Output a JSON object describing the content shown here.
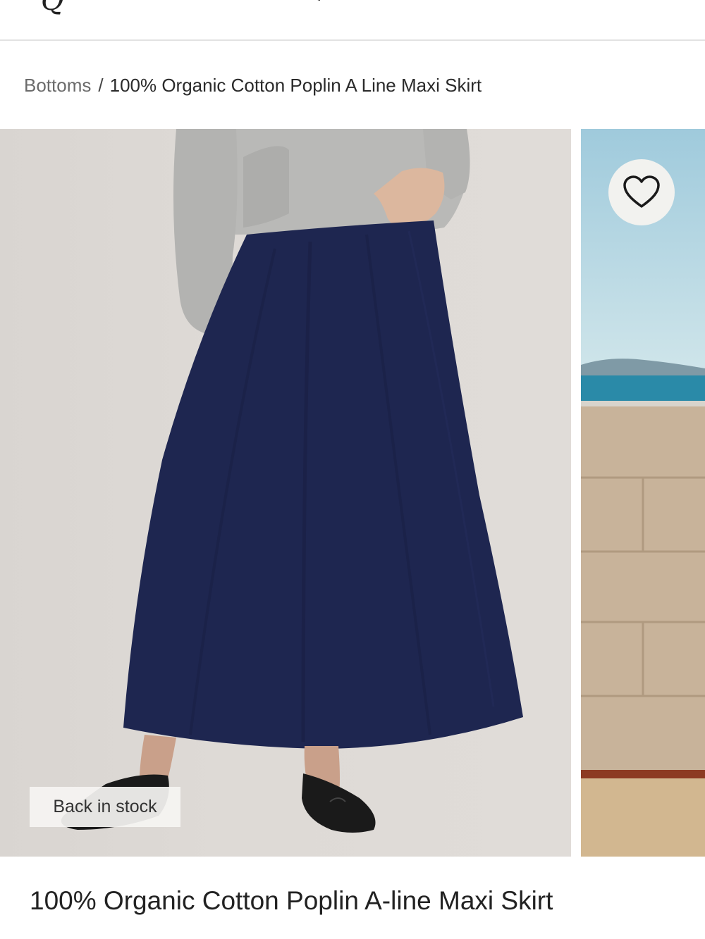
{
  "breadcrumb": {
    "category": "Bottoms",
    "separator": "/",
    "current": "100% Organic Cotton Poplin A Line Maxi Skirt"
  },
  "gallery": {
    "badge": "Back in stock",
    "favorite_icon": "heart-outline-icon"
  },
  "product": {
    "title": "100% Organic Cotton Poplin A-line Maxi Skirt"
  },
  "colors": {
    "skirt": "#1e2650",
    "sweater": "#b9b9b7",
    "backdrop": "#dcd8d4",
    "sky": "#a8d0e0",
    "sea": "#2a8aa8",
    "wall": "#c8b39a"
  }
}
